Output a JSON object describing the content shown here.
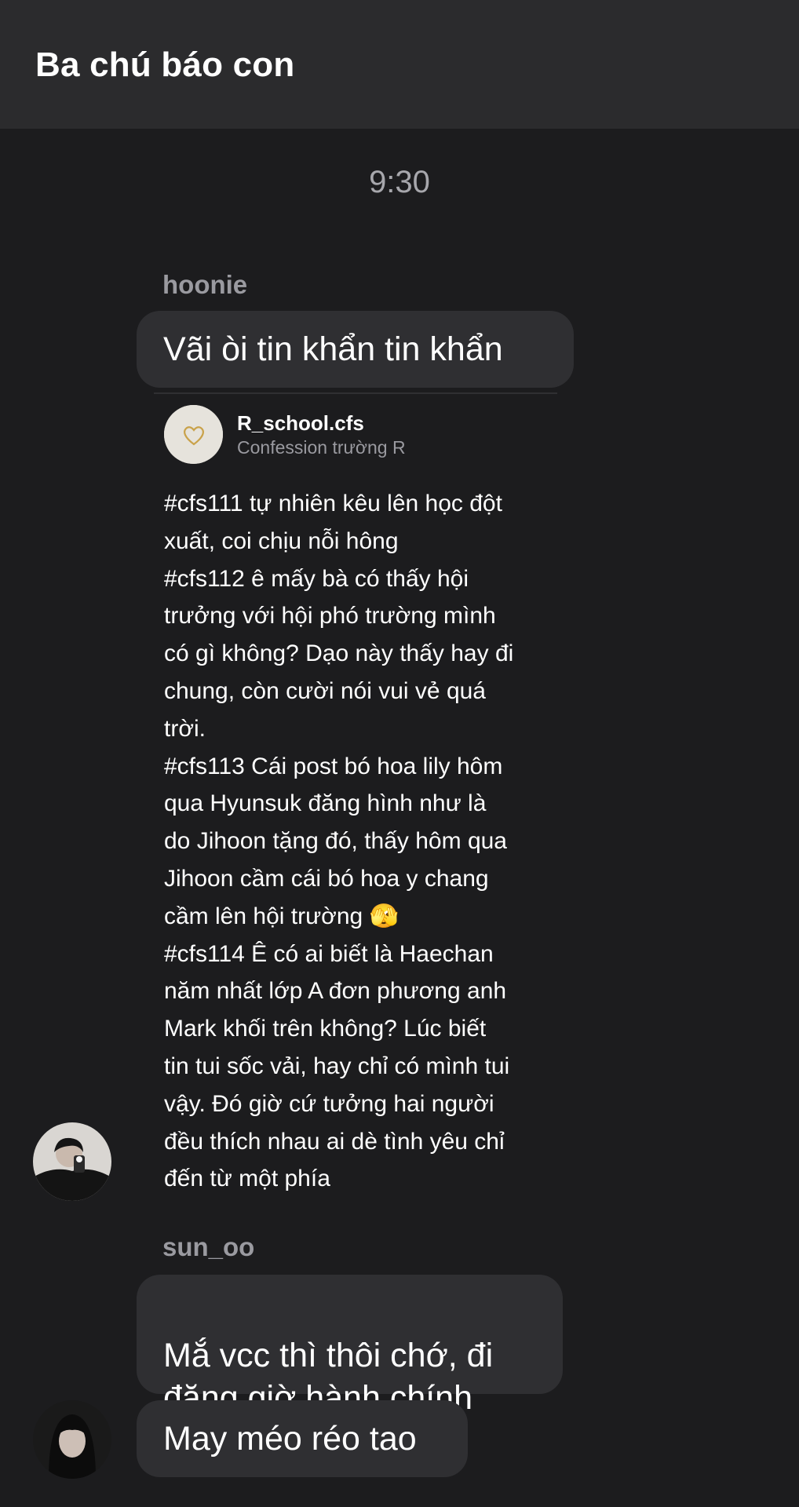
{
  "header": {
    "title": "Ba chú báo con"
  },
  "timestamp": "9:30",
  "messages": {
    "m1": {
      "sender": "hoonie",
      "text": "Vãi òi tin khẩn tin khẩn"
    },
    "post": {
      "author": "R_school.cfs",
      "subtitle": "Confession trường R",
      "body": "#cfs111 tự nhiên kêu lên học đột\nxuất, coi chịu nỗi hông\n#cfs112 ê mấy bà có thấy hội\ntrưởng với hội phó trường mình\ncó gì không? Dạo này thấy hay đi\nchung, còn cười nói vui vẻ quá\ntrời.\n#cfs113 Cái post bó hoa lily hôm\nqua Hyunsuk đăng hình như là\ndo Jihoon tặng đó, thấy hôm qua\nJihoon cầm cái bó hoa y chang\ncầm lên hội trường 🫣\n#cfs114 Ê có ai biết là Haechan\nnăm nhất lớp A đơn phương anh\nMark khối trên không? Lúc biết\ntin tui sốc vải, hay chỉ có mình tui\nvậy. Đó giờ cứ tưởng hai người\nđều thích nhau ai dè tình yêu chỉ\nđến từ một phía"
    },
    "m2": {
      "sender": "sun_oo",
      "text": "Mắ vcc thì thôi chớ, đi\nđăng giờ hành chính"
    },
    "m3": {
      "text": "May méo réo tao"
    }
  },
  "icons": {
    "avatar1": "profile-photo-hoonie",
    "avatar2": "profile-photo-sun_oo",
    "post_avatar": "heart-outline-icon"
  },
  "colors": {
    "background": "#1c1c1e",
    "header": "#2b2b2d",
    "bubble": "#2f2f32",
    "secondary_text": "#9a9aa0"
  }
}
